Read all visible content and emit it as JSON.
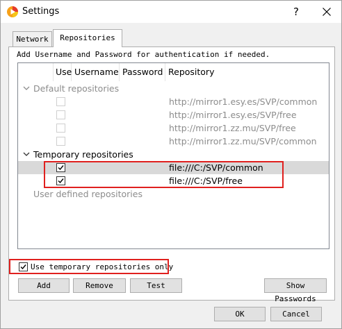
{
  "window": {
    "title": "Settings",
    "help_label": "?",
    "close_label": "✕"
  },
  "tabs": [
    {
      "label": "Network",
      "active": false
    },
    {
      "label": "Repositories",
      "active": true
    }
  ],
  "repositories": {
    "hint": "Add Username and Password for authentication if needed.",
    "columns": {
      "use": "Use",
      "username": "Username",
      "password": "Password",
      "repository": "Repository"
    },
    "groups": {
      "default": {
        "label": "Default repositories",
        "rows": [
          {
            "url": "http://mirror1.esy.es/SVP/common",
            "use": false
          },
          {
            "url": "http://mirror1.esy.es/SVP/free",
            "use": false
          },
          {
            "url": "http://mirror1.zz.mu/SVP/free",
            "use": false
          },
          {
            "url": "http://mirror1.zz.mu/SVP/common",
            "use": false
          }
        ]
      },
      "temporary": {
        "label": "Temporary repositories",
        "rows": [
          {
            "url": "file:///C:/SVP/common",
            "use": true
          },
          {
            "url": "file:///C:/SVP/free",
            "use": true
          }
        ]
      },
      "user": {
        "label": "User defined repositories"
      }
    },
    "use_temporary_only": {
      "label": "Use temporary repositories only",
      "checked": true
    }
  },
  "buttons": {
    "add": "Add",
    "remove": "Remove",
    "test": "Test",
    "show_passwords": "Show Passwords",
    "ok": "OK",
    "cancel": "Cancel"
  },
  "colors": {
    "highlight": "#e0201e",
    "selected_row": "#d9d9d9",
    "disabled_text": "#8c8c8c"
  }
}
